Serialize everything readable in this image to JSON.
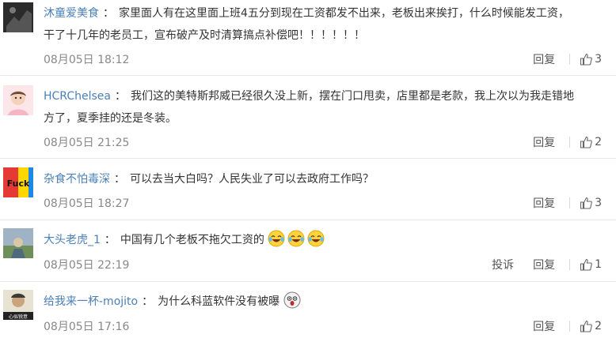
{
  "comments": [
    {
      "username": "沐童爱美食",
      "text_line1": "家里面人有在这里面上班4五分到现在工资都发不出来，老板出来挨打，什么时候能发工资，",
      "text_line2": "干了十几年的老员工，宣布破产及时清算搞点补偿吧！！！！！！",
      "date": "08月05日 18:12",
      "reply": "回复",
      "likes": "3"
    },
    {
      "username": "HCRChelsea",
      "text_line1": "我们这的美特斯邦威已经很久没上新，摆在门口甩卖，店里都是老款，我上次以为我走错地",
      "text_line2": "方了，夏季挂的还是冬装。",
      "date": "08月05日 21:25",
      "reply": "回复",
      "likes": "2"
    },
    {
      "username": "杂食不怕毒深",
      "text_line1": "可以去当大白吗？人民失业了可以去政府工作吗？",
      "avatar_text": "Fuck",
      "date": "08月05日 18:27",
      "reply": "回复",
      "likes": "3"
    },
    {
      "username": "大头老虎_1",
      "text_line1": "中国有几个老板不拖欠工资的",
      "date": "08月05日 22:19",
      "report": "投诉",
      "reply": "回复",
      "likes": "1"
    },
    {
      "username": "给我来一杯-mojito",
      "text_line1": "为什么科蓝软件没有被曝",
      "avatar_text": "心似锐意",
      "date": "08月05日 17:16",
      "reply": "回复",
      "likes": "2"
    }
  ],
  "separator": "：",
  "colors": {
    "username": "#4a7fba",
    "date": "#888888",
    "text": "#333333",
    "border": "#e9e9e9"
  }
}
